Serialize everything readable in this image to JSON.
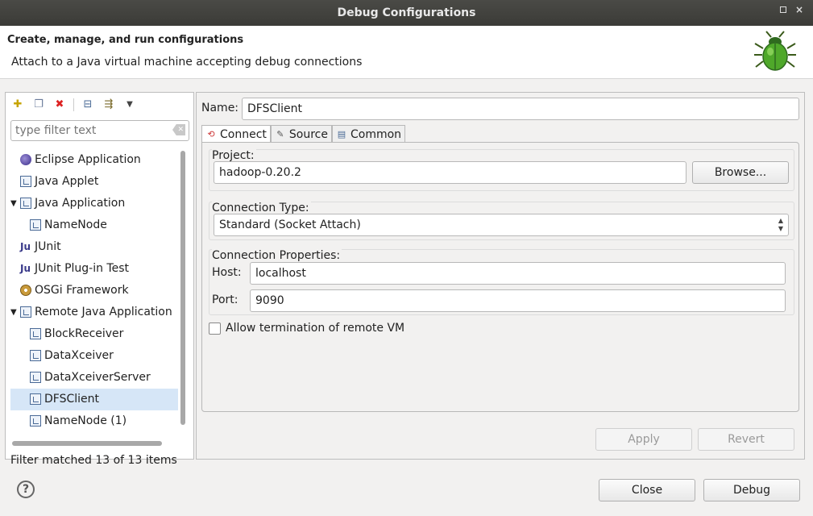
{
  "window": {
    "title": "Debug Configurations",
    "max_glyph": "",
    "close_glyph": "×"
  },
  "header": {
    "title": "Create, manage, and run configurations",
    "description": "Attach to a Java virtual machine accepting debug connections",
    "icon": "bug-icon"
  },
  "left": {
    "toolbar": [
      {
        "name": "new-config-icon",
        "glyph": "✚"
      },
      {
        "name": "duplicate-icon",
        "glyph": "❐"
      },
      {
        "name": "delete-icon",
        "glyph": "✖"
      },
      {
        "name": "collapse-all-icon",
        "glyph": "⊟"
      },
      {
        "name": "filter-icon",
        "glyph": "⇶"
      },
      {
        "name": "menu-dropdown-icon",
        "glyph": "▼"
      }
    ],
    "filter_placeholder": "type filter text",
    "filter_clear_glyph": "✕",
    "tree": [
      {
        "label": "Eclipse Application",
        "level": 0,
        "icon": "eclipse-icon"
      },
      {
        "label": "Java Applet",
        "level": 0,
        "icon": "java-applet-icon"
      },
      {
        "label": "Java Application",
        "level": 0,
        "icon": "java-application-icon",
        "expanded": true
      },
      {
        "label": "NameNode",
        "level": 1,
        "icon": "java-application-icon"
      },
      {
        "label": "JUnit",
        "level": 0,
        "icon": "junit-icon"
      },
      {
        "label": "JUnit Plug-in Test",
        "level": 0,
        "icon": "junit-plugin-icon"
      },
      {
        "label": "OSGi Framework",
        "level": 0,
        "icon": "osgi-icon"
      },
      {
        "label": "Remote Java Application",
        "level": 0,
        "icon": "remote-java-icon",
        "expanded": true
      },
      {
        "label": "BlockReceiver",
        "level": 1,
        "icon": "remote-java-icon"
      },
      {
        "label": "DataXceiver",
        "level": 1,
        "icon": "remote-java-icon"
      },
      {
        "label": "DataXceiverServer",
        "level": 1,
        "icon": "remote-java-icon"
      },
      {
        "label": "DFSClient",
        "level": 1,
        "icon": "remote-java-icon",
        "selected": true
      },
      {
        "label": "NameNode (1)",
        "level": 1,
        "icon": "remote-java-icon"
      }
    ],
    "filter_status": "Filter matched 13 of 13 items"
  },
  "right": {
    "name_label": "Name:",
    "name_value": "DFSClient",
    "tabs": [
      {
        "label": "Connect",
        "icon": "connect-icon",
        "glyph": "⟲",
        "active": true
      },
      {
        "label": "Source",
        "icon": "source-icon",
        "glyph": "✎",
        "active": false
      },
      {
        "label": "Common",
        "icon": "common-icon",
        "glyph": "▤",
        "active": false
      }
    ],
    "project_label": "Project:",
    "project_value": "hadoop-0.20.2",
    "browse_label": "Browse...",
    "connection_type_label": "Connection Type:",
    "connection_type_value": "Standard (Socket Attach)",
    "connection_props_label": "Connection Properties:",
    "host_label": "Host:",
    "host_value": "localhost",
    "port_label": "Port:",
    "port_value": "9090",
    "allow_termination_label": "Allow termination of remote VM",
    "allow_termination_checked": false,
    "apply_label": "Apply",
    "revert_label": "Revert"
  },
  "footer": {
    "help_glyph": "?",
    "close_label": "Close",
    "debug_label": "Debug"
  }
}
